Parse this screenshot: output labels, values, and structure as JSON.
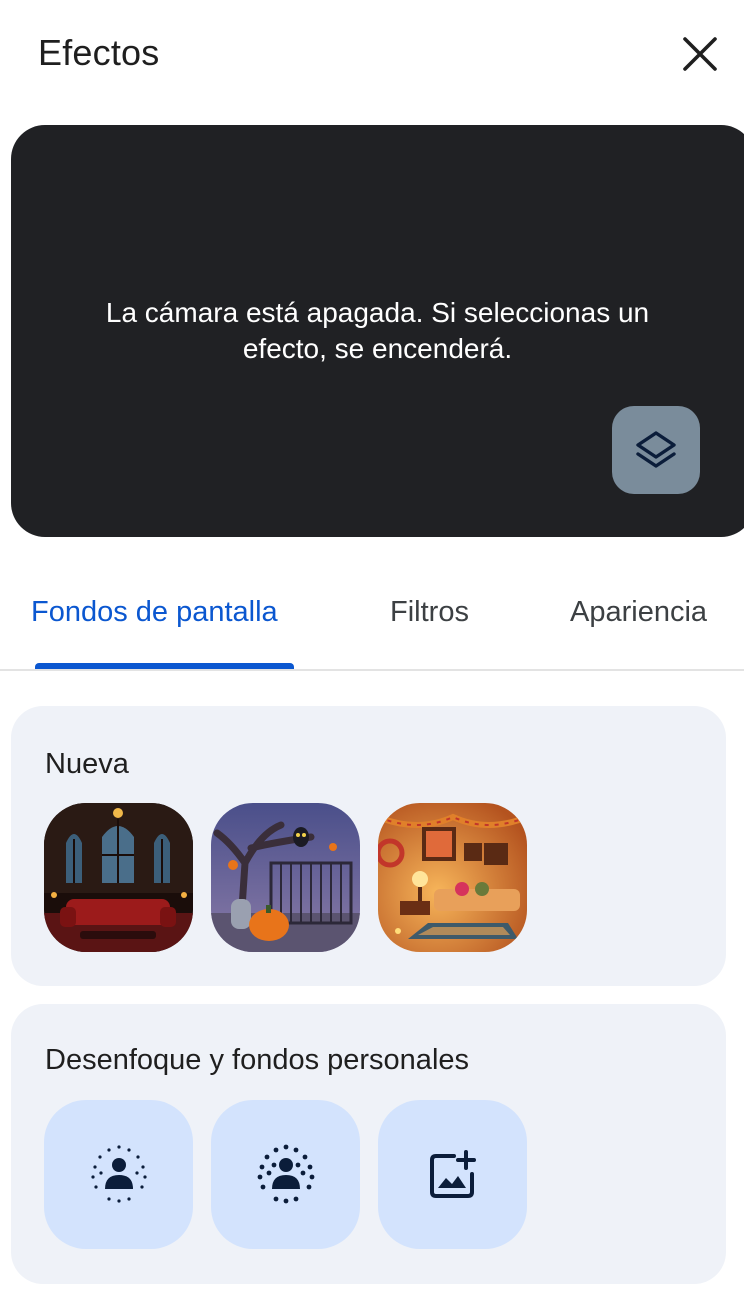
{
  "header": {
    "title": "Efectos",
    "close_icon": "close-icon"
  },
  "preview": {
    "message": "La cámara está apagada. Si seleccionas un efecto, se encenderá.",
    "layers_icon": "layers-icon"
  },
  "tabs": [
    {
      "label": "Fondos de pantalla",
      "selected": true
    },
    {
      "label": "Filtros",
      "selected": false
    },
    {
      "label": "Apariencia",
      "selected": false
    }
  ],
  "sections": {
    "new": {
      "title": "Nueva",
      "items": [
        {
          "name": "gothic-room-background"
        },
        {
          "name": "halloween-graveyard-background"
        },
        {
          "name": "festive-living-room-background"
        }
      ]
    },
    "blur": {
      "title": "Desenfoque y fondos personales",
      "items": [
        {
          "icon": "slight-blur-icon"
        },
        {
          "icon": "blur-icon"
        },
        {
          "icon": "add-image-icon"
        }
      ]
    }
  },
  "colors": {
    "accent": "#0b57d0",
    "preview_bg": "#202124",
    "card_bg": "#eff2f8",
    "tile_bg": "#d3e3fd",
    "icon_dark": "#0b1d3a"
  }
}
